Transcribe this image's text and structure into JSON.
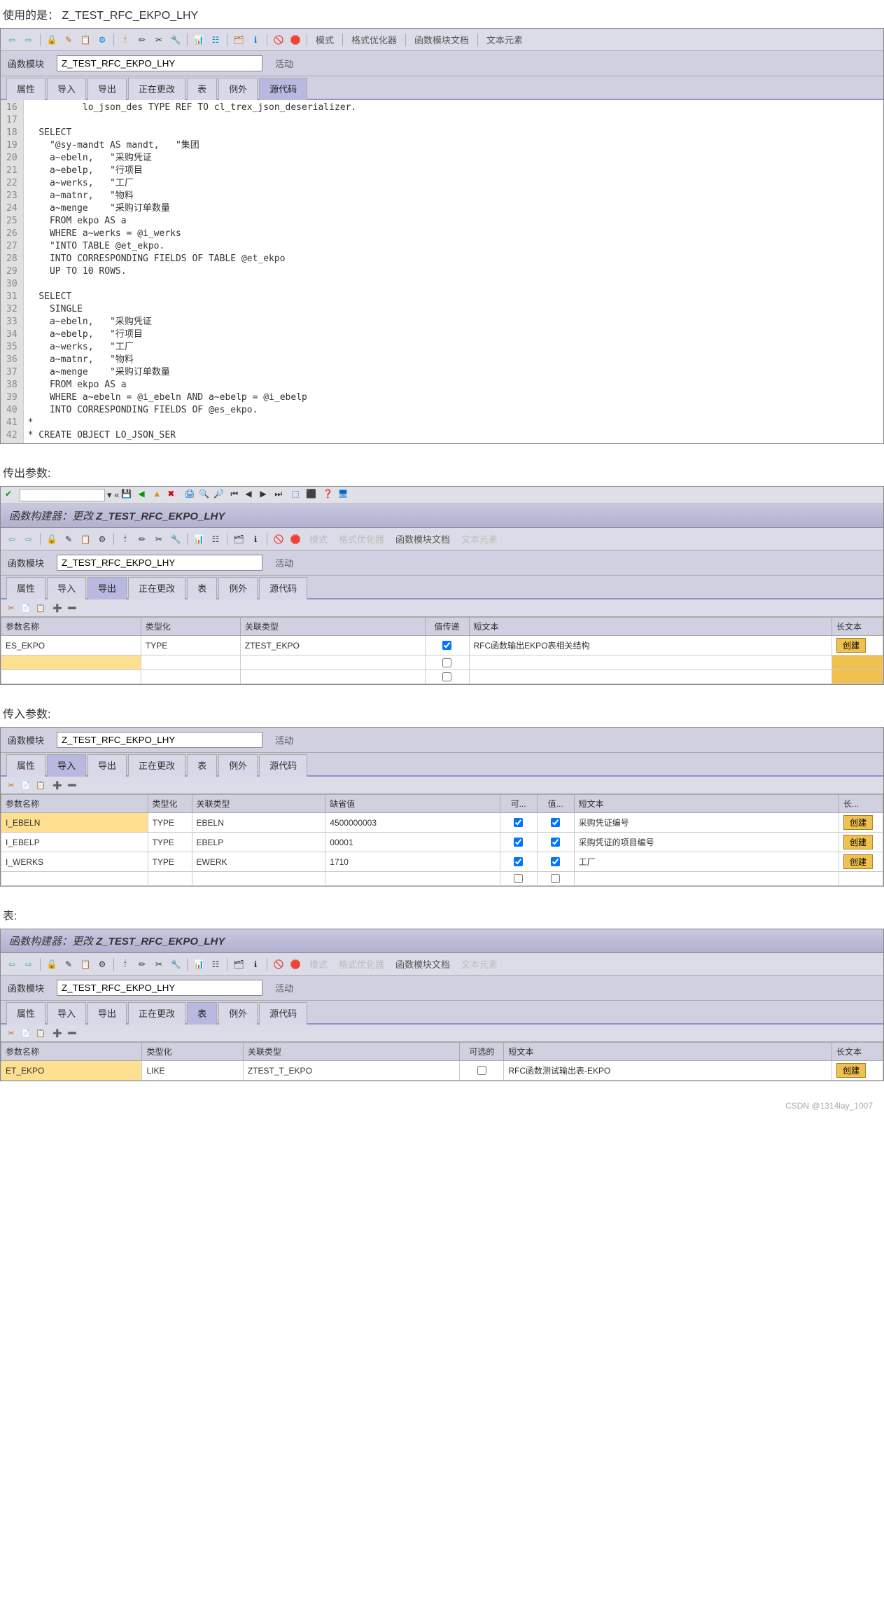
{
  "labels": {
    "used": "使用的是：",
    "module_name": "Z_TEST_RFC_EKPO_LHY",
    "export_params": "传出参数:",
    "import_params": "传入参数:",
    "tables": "表:",
    "fn_module": "函数模块",
    "active": "活动",
    "builder_title_prefix": "函数构建器：更改 ",
    "credit": "CSDN @1314lay_1007"
  },
  "toolbar_text": {
    "mode": "模式",
    "formatter": "格式优化器",
    "docs": "函数模块文档",
    "text_elem": "文本元素"
  },
  "tabs": {
    "attr": "属性",
    "import": "导入",
    "export": "导出",
    "changing": "正在更改",
    "tables": "表",
    "exceptions": "例外",
    "source": "源代码"
  },
  "code_start": 16,
  "code_lines": [
    "          lo_json_des <kw>TYPE REF TO</kw> cl_trex_json_deserializer.",
    "",
    "  <kw>SELECT</kw>",
    "    <str>\"@sy-mandt AS mandt,   \"集团</str>",
    "    a~ebeln,   <str>\"采购凭证</str>",
    "    a~ebelp,   <str>\"行项目</str>",
    "    a~werks,   <str>\"工厂</str>",
    "    a~matnr,   <str>\"物料</str>",
    "    a~menge    <str>\"采购订单数量</str>",
    "    <kw>FROM</kw> ekpo <kw>AS</kw> a",
    "    <kw>WHERE</kw> a~werks = @i_werks",
    "    <str>\"INTO TABLE @et_ekpo.</str>",
    "    <kw>INTO CORRESPONDING FIELDS OF TABLE</kw> @et_ekpo",
    "    <kw>UP TO</kw> <num>10</num> <kw>ROWS</kw>.",
    "",
    "  <kw>SELECT</kw>",
    "    <kw>SINGLE</kw>",
    "    a~ebeln,   <str>\"采购凭证</str>",
    "    a~ebelp,   <str>\"行项目</str>",
    "    a~werks,   <str>\"工厂</str>",
    "    a~matnr,   <str>\"物料</str>",
    "    a~menge    <str>\"采购订单数量</str>",
    "    <kw>FROM</kw> ekpo <kw>AS</kw> a",
    "    <kw>WHERE</kw> a~ebeln = @i_ebeln <kw>AND</kw> a~ebelp = @i_ebelp",
    "    <kw>INTO CORRESPONDING FIELDS OF</kw> @es_ekpo.",
    "<str>*</str>",
    "<str>* CREATE OBJECT LO_JSON_SER</str>"
  ],
  "grid_headers": {
    "param_name": "参数名称",
    "typing": "类型化",
    "ref_type": "关联类型",
    "default": "缺省值",
    "pass_value": "值传递",
    "optional": "可选的",
    "opt": "可...",
    "val": "值...",
    "short_text": "短文本",
    "long_text": "长文本",
    "long": "长...",
    "create": "创建"
  },
  "export_rows": [
    {
      "name": "ES_EKPO",
      "typing": "TYPE",
      "ref": "ZTEST_EKPO",
      "pass": true,
      "text": "RFC函数输出EKPO表相关结构"
    }
  ],
  "import_rows": [
    {
      "name": "I_EBELN",
      "typing": "TYPE",
      "ref": "EBELN",
      "default": "4500000003",
      "opt": true,
      "val": true,
      "text": "采购凭证编号",
      "hl": true
    },
    {
      "name": "I_EBELP",
      "typing": "TYPE",
      "ref": "EBELP",
      "default": "00001",
      "opt": true,
      "val": true,
      "text": "采购凭证的项目编号"
    },
    {
      "name": "I_WERKS",
      "typing": "TYPE",
      "ref": "EWERK",
      "default": "1710",
      "opt": true,
      "val": true,
      "text": "工厂"
    }
  ],
  "table_rows": [
    {
      "name": "ET_EKPO",
      "typing": "LIKE",
      "ref": "ZTEST_T_EKPO",
      "opt": false,
      "text": "RFC函数测试输出表-EKPO",
      "hl": true
    }
  ]
}
